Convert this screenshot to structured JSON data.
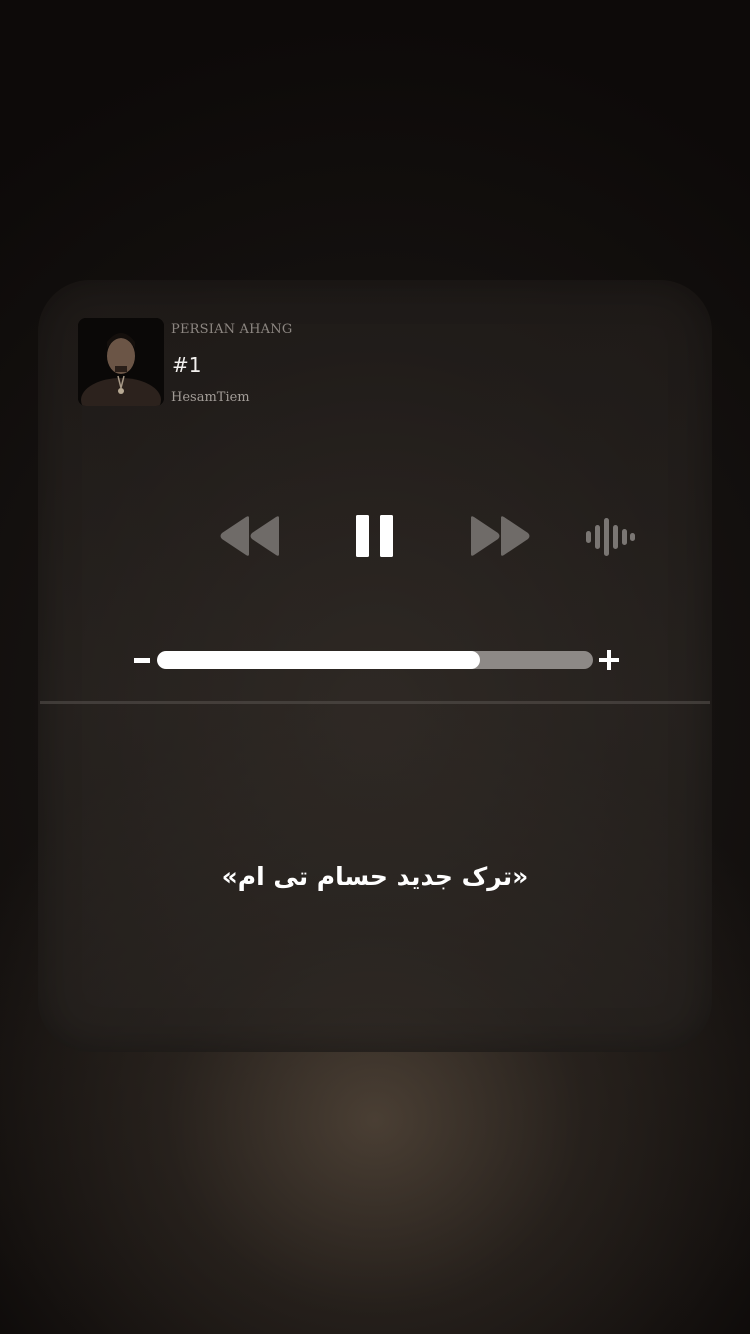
{
  "now_playing": {
    "source": "PERSIAN AHANG",
    "title": "#1",
    "artist": "HesamTiem"
  },
  "controls": {
    "rewind_icon": "rewind-icon",
    "pause_icon": "pause-icon",
    "forward_icon": "fast-forward-icon",
    "waveform_icon": "waveform-icon"
  },
  "volume": {
    "level": 0.74,
    "minus_icon": "minus-icon",
    "plus_icon": "plus-icon"
  },
  "caption": "«ترک جدید حسام تی ام»",
  "colors": {
    "accent": "#ffffff",
    "track": "#8d8986",
    "muted_icon": "#6f6b68"
  }
}
